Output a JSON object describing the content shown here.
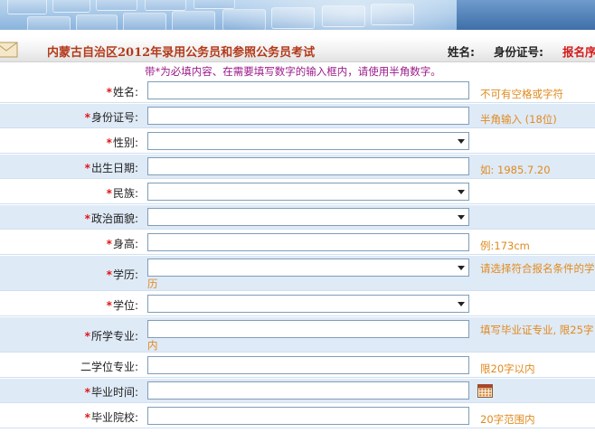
{
  "header": {
    "title": "内蒙古自治区2012年录用公务员和参照公务员考试",
    "name_label": "姓名:",
    "id_label": "身份证号:",
    "reg_label": "报名序"
  },
  "notice": "带*为必填内容、在需要填写数字的输入框内，请使用半角数字。",
  "colors": {
    "required": "#e01515",
    "hint": "#e08a1e",
    "title": "#b33a1a",
    "notice": "#9b1b8a"
  },
  "form": {
    "fields": [
      {
        "label": "姓名:",
        "required": true,
        "type": "text",
        "value": "",
        "hint": "不可有空格或字符"
      },
      {
        "label": "身份证号:",
        "required": true,
        "type": "text",
        "value": "",
        "hint": "半角输入 (18位)"
      },
      {
        "label": "性别:",
        "required": true,
        "type": "select",
        "value": "",
        "hint": ""
      },
      {
        "label": "出生日期:",
        "required": true,
        "type": "text",
        "value": "",
        "hint": "如: 1985.7.20"
      },
      {
        "label": "民族:",
        "required": true,
        "type": "select",
        "value": "",
        "hint": ""
      },
      {
        "label": "政治面貌:",
        "required": true,
        "type": "select",
        "value": "",
        "hint": ""
      },
      {
        "label": "身高:",
        "required": true,
        "type": "text",
        "value": "",
        "hint": "例:173cm"
      },
      {
        "label": "学历:",
        "required": true,
        "type": "select",
        "value": "",
        "hint": "请选择符合报名条件的学",
        "hint_wrap": "历"
      },
      {
        "label": "学位:",
        "required": true,
        "type": "select",
        "value": "",
        "hint": ""
      },
      {
        "label": "所学专业:",
        "required": true,
        "type": "text",
        "value": "",
        "hint": "填写毕业证专业, 限25字",
        "hint_wrap": "内"
      },
      {
        "label": "二学位专业:",
        "required": false,
        "type": "text",
        "value": "",
        "hint": "限20字以内"
      },
      {
        "label": "毕业时间:",
        "required": true,
        "type": "date",
        "value": "",
        "hint": "",
        "icon": "calendar-icon"
      },
      {
        "label": "毕业院校:",
        "required": true,
        "type": "text",
        "value": "",
        "hint": "20字范围内"
      }
    ]
  }
}
